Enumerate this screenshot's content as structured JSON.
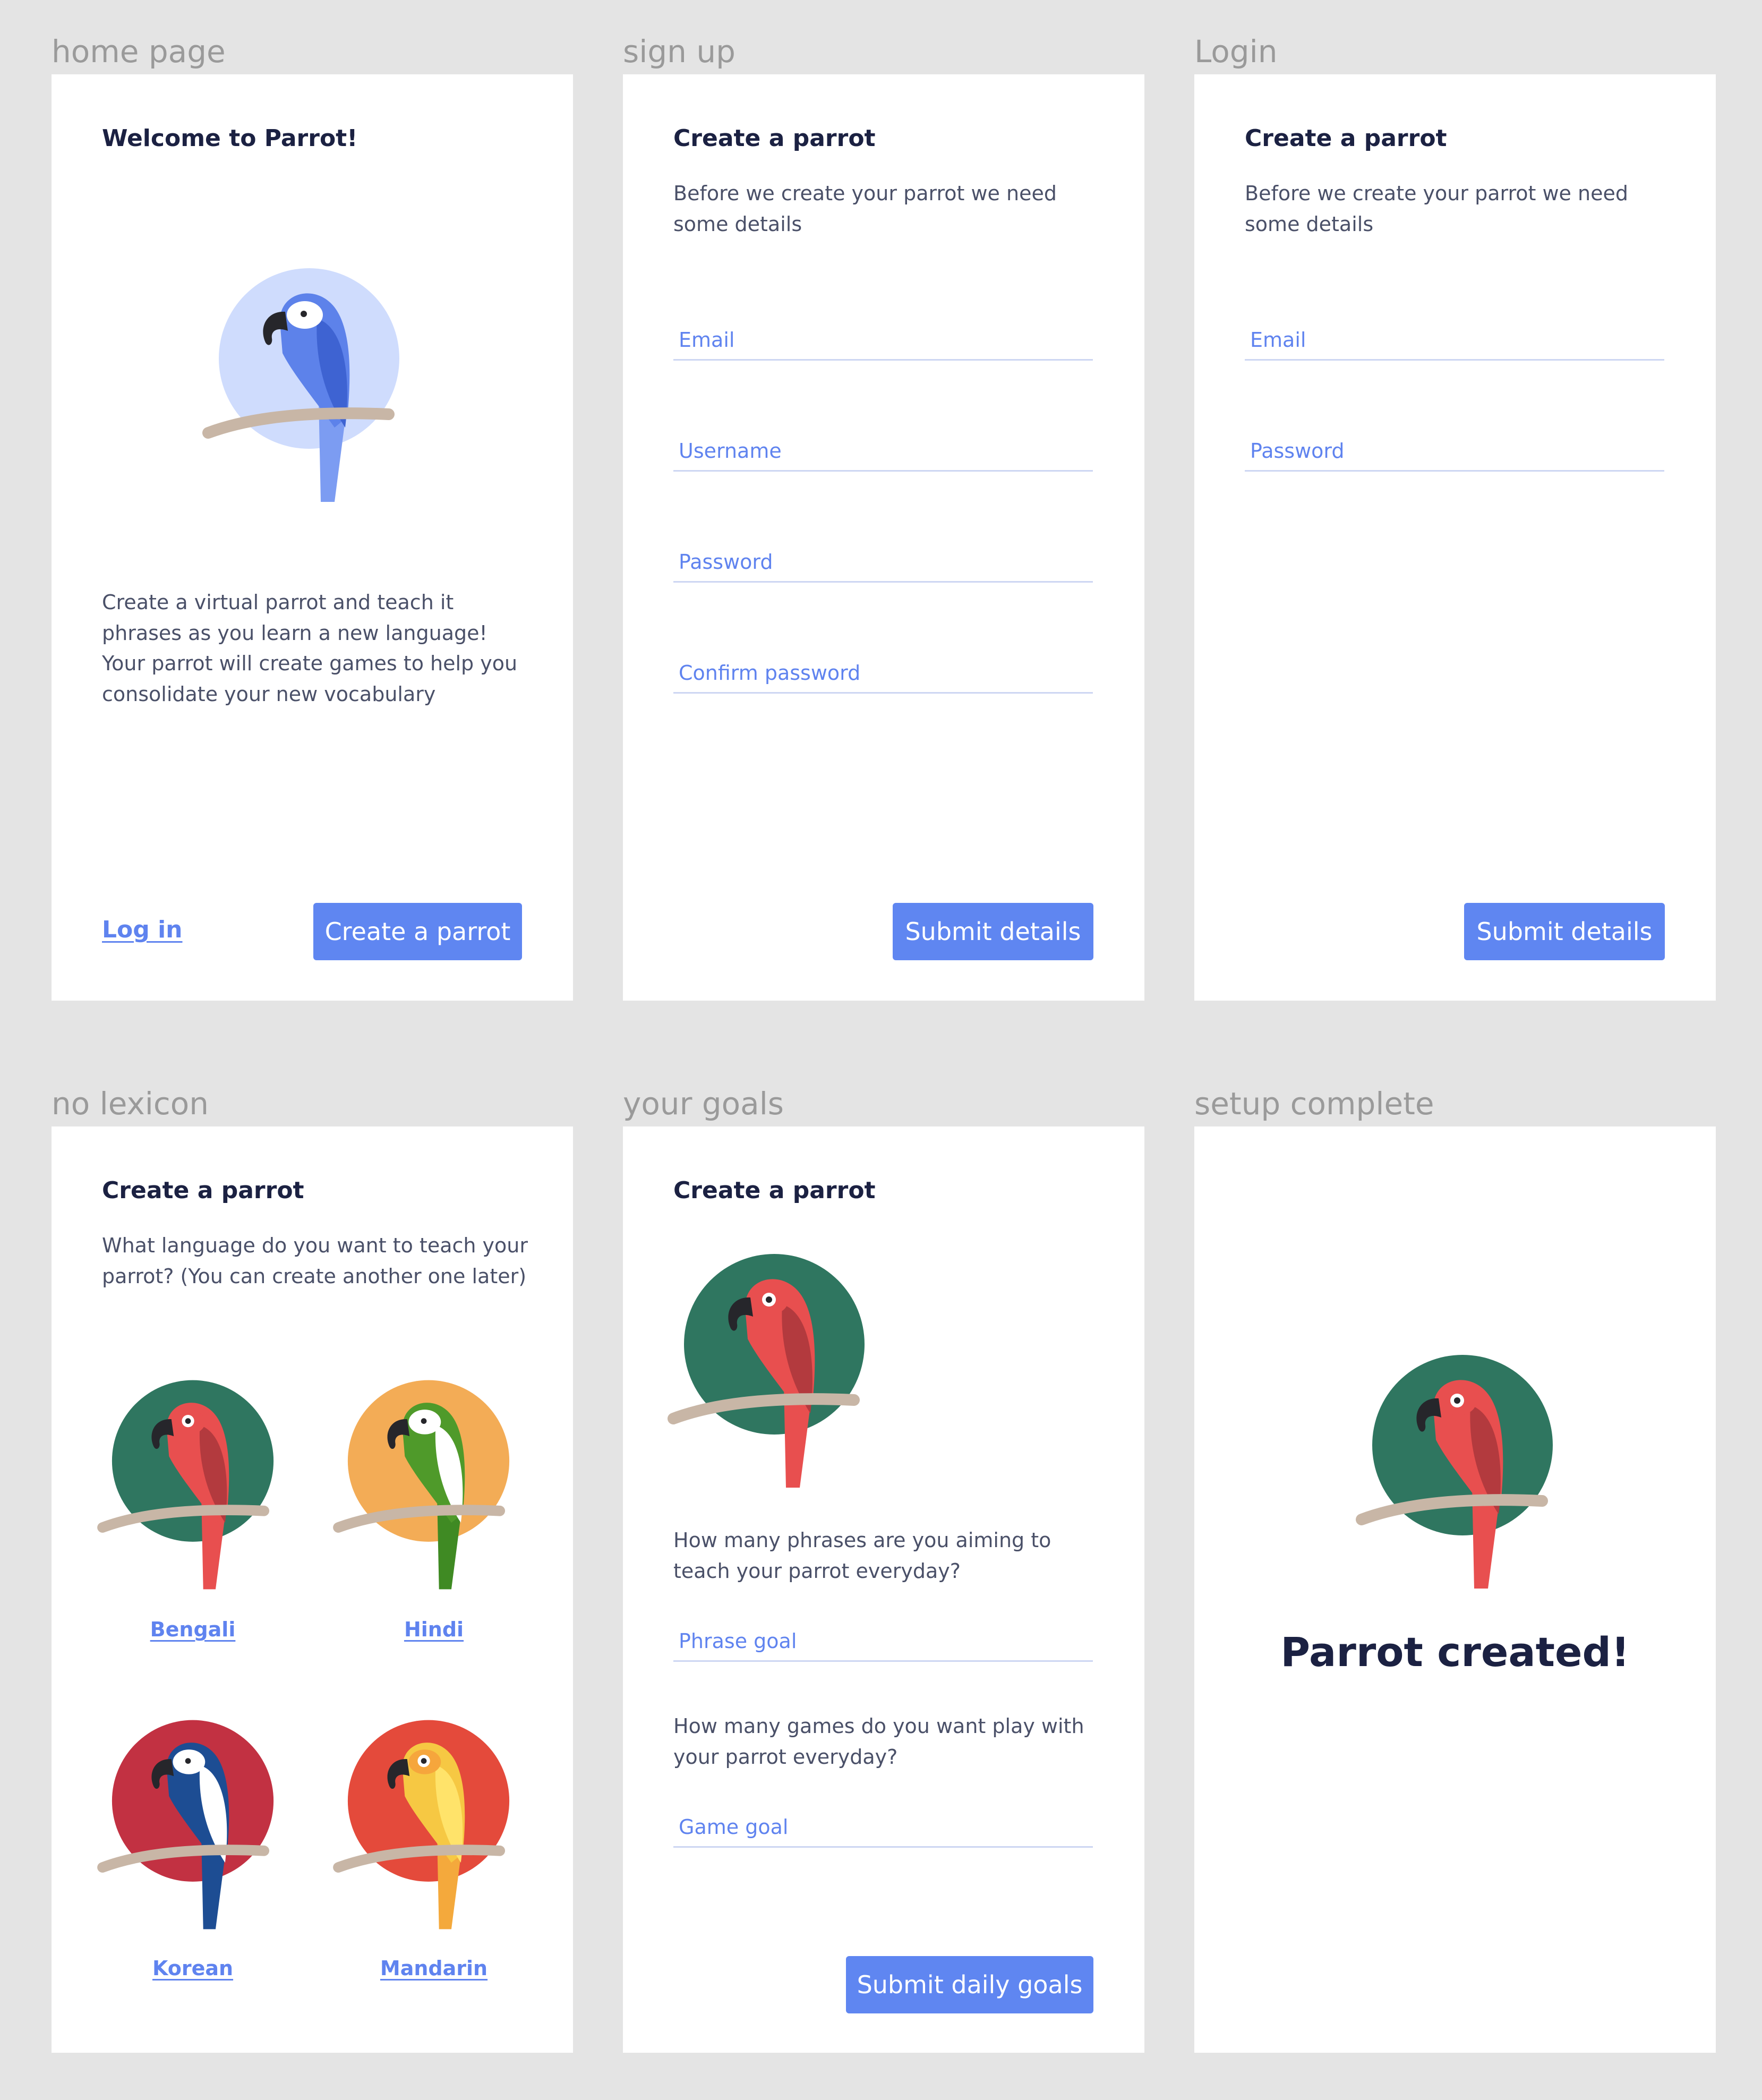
{
  "frames": {
    "home": {
      "label": "home page",
      "title": "Welcome to Parrot!",
      "intro_line1": "Create a virtual parrot and teach it phrases as you learn a new language!",
      "intro_line2": "Your parrot will create games to help you consolidate your new vocabulary",
      "login_link": "Log in",
      "create_button": "Create a parrot",
      "parrot": {
        "bg": "#cfdcfd",
        "body": "#5d82ea",
        "wing": "#3e63d2",
        "face": "#ffffff",
        "tail": "#7c9cf2",
        "beak": "#26262b"
      }
    },
    "signup": {
      "label": "sign up",
      "title": "Create a parrot",
      "description": "Before we create your parrot we need some details",
      "fields": [
        "Email",
        "Username",
        "Password",
        "Confirm password"
      ],
      "submit_button": "Submit details"
    },
    "login": {
      "label": "Login",
      "title": "Create a parrot",
      "description": "Before we create your parrot we need some details",
      "fields": [
        "Email",
        "Password"
      ],
      "submit_button": "Submit details"
    },
    "lexicon": {
      "label": "no lexicon",
      "title": "Create a parrot",
      "description": "What language do you want to teach your parrot? (You can create another one later)",
      "languages": [
        {
          "name": "Bengali",
          "bg": "#2f7660",
          "body": "#e84f4f",
          "wing": "#b33a3e",
          "face": "#e84f4f",
          "tail": "#e84f4f",
          "beak": "#26262b"
        },
        {
          "name": "Hindi",
          "bg": "#f3ac56",
          "body": "#4f9a2a",
          "wing": "#ffffff",
          "face": "#ffffff",
          "tail": "#3f8a23",
          "beak": "#26262b"
        },
        {
          "name": "Korean",
          "bg": "#c23142",
          "body": "#1d4d93",
          "wing": "#ffffff",
          "face": "#ffffff",
          "tail": "#1d4d93",
          "beak": "#26262b"
        },
        {
          "name": "Mandarin",
          "bg": "#e44a3b",
          "body": "#f6c843",
          "wing": "#ffe36a",
          "face": "#f6a63c",
          "tail": "#f4a93c",
          "beak": "#26262b"
        }
      ]
    },
    "goals": {
      "label": "your goals",
      "title": "Create a parrot",
      "phrase_question": "How many phrases are you aiming to teach your parrot everyday?",
      "phrase_field": "Phrase goal",
      "game_question": "How many games do you want play with your parrot everyday?",
      "game_field": "Game goal",
      "submit_button": "Submit daily goals",
      "parrot": {
        "bg": "#2f7660",
        "body": "#e84f4f",
        "wing": "#b33a3e",
        "face": "#e84f4f",
        "tail": "#e84f4f",
        "beak": "#26262b"
      }
    },
    "complete": {
      "label": "setup complete",
      "message": "Parrot created!",
      "parrot": {
        "bg": "#2f7660",
        "body": "#e84f4f",
        "wing": "#b33a3e",
        "face": "#e84f4f",
        "tail": "#e84f4f",
        "beak": "#26262b"
      }
    }
  },
  "perch_color": "#c8b6a6"
}
